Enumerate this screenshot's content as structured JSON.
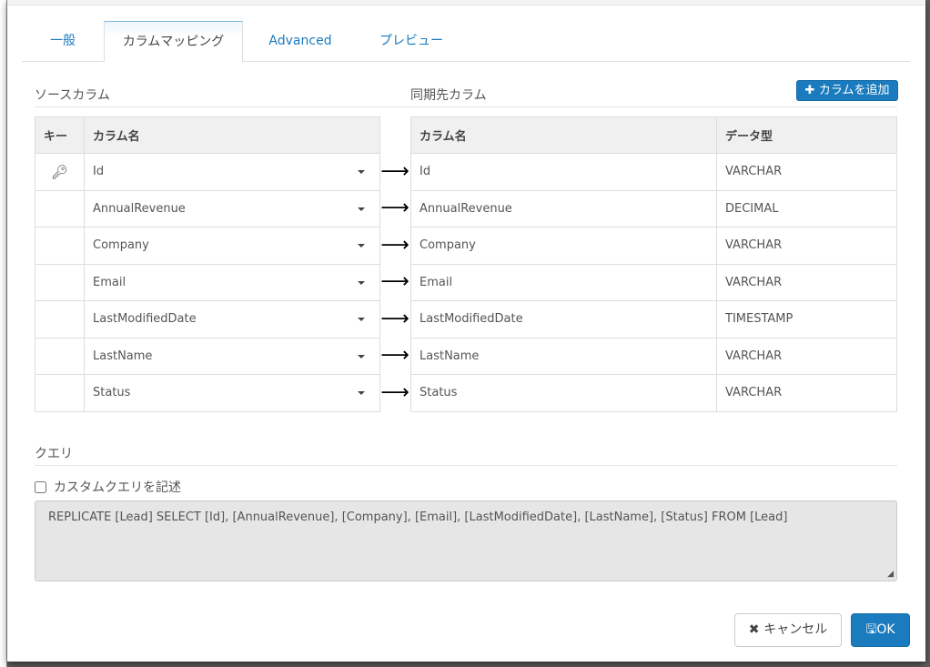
{
  "tabs": [
    {
      "label": "一般"
    },
    {
      "label": "カラムマッピング"
    },
    {
      "label": "Advanced"
    },
    {
      "label": "プレビュー"
    }
  ],
  "source_heading": "ソースカラム",
  "dest_heading": "同期先カラム",
  "add_column_label": "カラムを追加",
  "source_table": {
    "headers": [
      "キー",
      "カラム名"
    ],
    "rows": [
      {
        "key": true,
        "name": "Id"
      },
      {
        "key": false,
        "name": "AnnualRevenue"
      },
      {
        "key": false,
        "name": "Company"
      },
      {
        "key": false,
        "name": "Email"
      },
      {
        "key": false,
        "name": "LastModifiedDate"
      },
      {
        "key": false,
        "name": "LastName"
      },
      {
        "key": false,
        "name": "Status"
      }
    ]
  },
  "dest_table": {
    "headers": [
      "カラム名",
      "データ型"
    ],
    "rows": [
      {
        "name": "Id",
        "type": "VARCHAR"
      },
      {
        "name": "AnnualRevenue",
        "type": "DECIMAL"
      },
      {
        "name": "Company",
        "type": "VARCHAR"
      },
      {
        "name": "Email",
        "type": "VARCHAR"
      },
      {
        "name": "LastModifiedDate",
        "type": "TIMESTAMP"
      },
      {
        "name": "LastName",
        "type": "VARCHAR"
      },
      {
        "name": "Status",
        "type": "VARCHAR"
      }
    ]
  },
  "arrow": "⟶",
  "query_heading": "クエリ",
  "custom_query_label": "カスタムクエリを記述",
  "custom_query_checked": false,
  "query_text": "REPLICATE [Lead] SELECT [Id], [AnnualRevenue], [Company], [Email], [LastModifiedDate], [LastName], [Status] FROM [Lead]",
  "cancel_label": "キャンセル",
  "ok_label": "OK"
}
